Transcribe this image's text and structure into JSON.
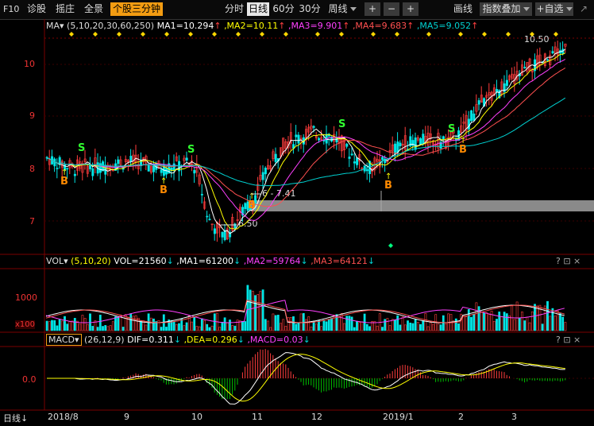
{
  "toolbar": {
    "f10": "F10",
    "diagnose": "诊股",
    "pick": "摇庄",
    "full": "全景",
    "tab_stock_3min": "个股三分钟",
    "period_time": "分时",
    "period_day": "日线",
    "period_60": "60分",
    "period_30": "30分",
    "period_week": "周线",
    "draw_line": "画线",
    "indicator_overlay": "指数叠加",
    "watchlist": "自选",
    "plus1": "+",
    "minus": "−",
    "plus2": "+"
  },
  "main_legend": {
    "ma_label": "MA",
    "ma_periods": "(5,10,20,30,60,250)",
    "ma1": "MA1=10.294",
    "ma2": ",MA2=10.11",
    "ma3": ",MA3=9.901",
    "ma4": ",MA4=9.683",
    "ma5": ",MA5=9.052"
  },
  "vol_legend": {
    "label": "VOL",
    "periods": "(5,10,20)",
    "vol": "VOL=21560",
    "ma1": ",MA1=61200",
    "ma2": ",MA2=59764",
    "ma3": ",MA3=64121"
  },
  "macd_legend": {
    "label": "MACD",
    "periods": "(26,12,9)",
    "dif": "DIF=0.311",
    "dea": ",DEA=0.296",
    "macd": ",MACD=0.03"
  },
  "panel_ctrl": "? ⊡ ×",
  "price_axis": [
    "10",
    "9",
    "8",
    "7"
  ],
  "vol_axis": [
    "1000",
    "x100"
  ],
  "macd_axis": [
    "0.0"
  ],
  "annotations": {
    "high": "10.50",
    "low": "6.50",
    "range_label": "6 - 7.41",
    "buy": "B",
    "sell": "S"
  },
  "dates": [
    "2018/8",
    "9",
    "10",
    "11",
    "12",
    "2019/1",
    "2",
    "3"
  ],
  "bottom_left": "日线",
  "colors": {
    "up": "#ff3c3c",
    "down": "#00e5e5",
    "ma5": "#ffffff",
    "ma10": "#ffff00",
    "ma20": "#ff40ff",
    "ma30": "#ff5050",
    "ma60": "#00d0d0",
    "accent": "#f39c12"
  }
}
